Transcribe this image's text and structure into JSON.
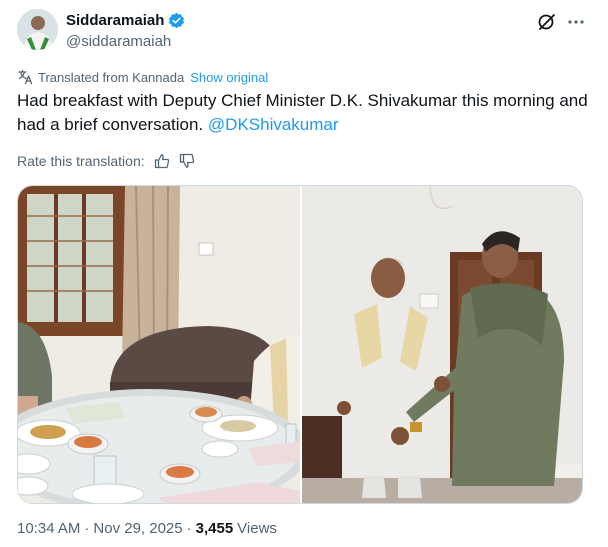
{
  "author": {
    "display_name": "Siddaramaiah",
    "handle": "@siddaramaiah",
    "verified": true
  },
  "icons": {
    "verified": "verified-badge-icon",
    "grok": "grok-icon",
    "more": "more-icon",
    "translate": "translate-icon",
    "thumbs_up": "thumbs-up-icon",
    "thumbs_down": "thumbs-down-icon"
  },
  "translation": {
    "label": "Translated from Kannada",
    "show_original": "Show original"
  },
  "tweet": {
    "text": "Had breakfast with Deputy Chief Minister D.K. Shivakumar this morning and had a brief conversation.",
    "mention": "@DKShivakumar"
  },
  "rating": {
    "label": "Rate this translation:"
  },
  "meta": {
    "time": "10:34 AM",
    "separator": "·",
    "date": "Nov 29, 2025",
    "views_count": "3,455",
    "views_label": "Views"
  },
  "colors": {
    "accent": "#1d9bf0",
    "text": "#0f1419",
    "secondary": "#536471",
    "border": "#cfd9de"
  }
}
